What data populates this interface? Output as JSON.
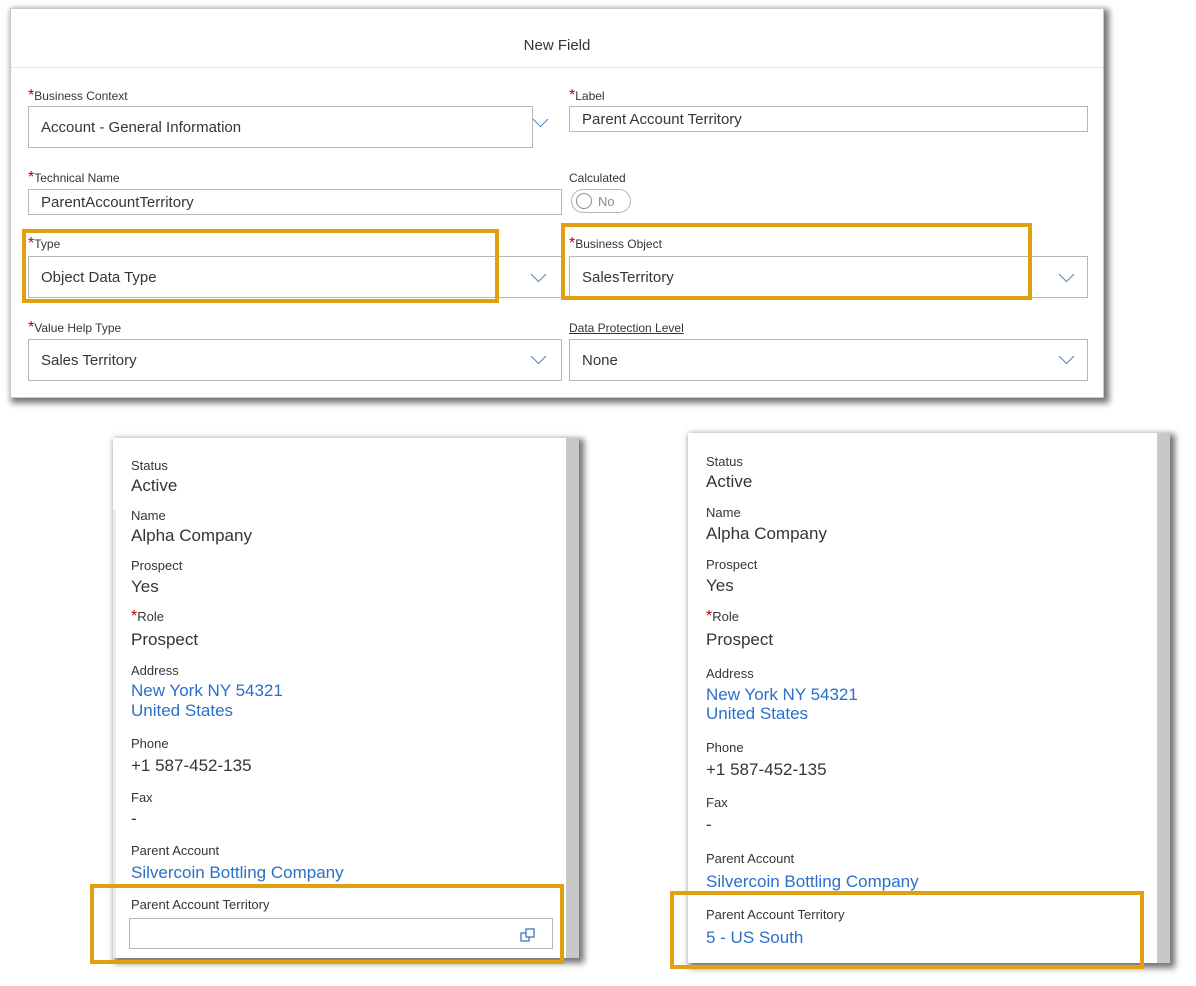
{
  "dialog": {
    "title": "New Field",
    "business_context": {
      "label": "Business Context",
      "value": "Account - General Information"
    },
    "label_field": {
      "label": "Label",
      "value": "Parent Account Territory"
    },
    "technical_name": {
      "label": "Technical Name",
      "value": "ParentAccountTerritory"
    },
    "calculated": {
      "label": "Calculated",
      "value": "No"
    },
    "type": {
      "label": "Type",
      "value": "Object Data Type"
    },
    "business_object": {
      "label": "Business Object",
      "value": "SalesTerritory"
    },
    "value_help_type": {
      "label": "Value Help Type",
      "value": "Sales Territory"
    },
    "data_protection_level": {
      "label": "Data Protection Level",
      "value": "None"
    },
    "required_marker": "*"
  },
  "detail_left": {
    "status": {
      "label": "Status",
      "value": "Active"
    },
    "name": {
      "label": "Name",
      "value": "Alpha Company"
    },
    "prospect": {
      "label": "Prospect",
      "value": "Yes"
    },
    "role": {
      "label": "Role",
      "value": "Prospect"
    },
    "address": {
      "label": "Address",
      "line1": "New York NY 54321",
      "line2": "United States"
    },
    "phone": {
      "label": "Phone",
      "value": "+1 587-452-135"
    },
    "fax": {
      "label": "Fax",
      "value": "-"
    },
    "parent_account": {
      "label": "Parent Account",
      "value": "Silvercoin Bottling Company"
    },
    "parent_account_territory": {
      "label": "Parent Account Territory",
      "value": ""
    }
  },
  "detail_right": {
    "status": {
      "label": "Status",
      "value": "Active"
    },
    "name": {
      "label": "Name",
      "value": "Alpha Company"
    },
    "prospect": {
      "label": "Prospect",
      "value": "Yes"
    },
    "role": {
      "label": "Role",
      "value": "Prospect"
    },
    "address": {
      "label": "Address",
      "line1": "New York NY 54321",
      "line2": "United States"
    },
    "phone": {
      "label": "Phone",
      "value": "+1 587-452-135"
    },
    "fax": {
      "label": "Fax",
      "value": "-"
    },
    "parent_account": {
      "label": "Parent Account",
      "value": "Silvercoin Bottling Company"
    },
    "parent_account_territory": {
      "label": "Parent Account Territory",
      "value": "5 - US South"
    }
  },
  "colors": {
    "highlight": "#e2a011",
    "link": "#2a6fc9",
    "required": "#bb0000",
    "chevron": "#4b7fbf"
  },
  "icons": {
    "dropdown": "chevron-down-icon",
    "lookup": "open-value-help-icon",
    "toggle": "toggle-off-icon"
  }
}
